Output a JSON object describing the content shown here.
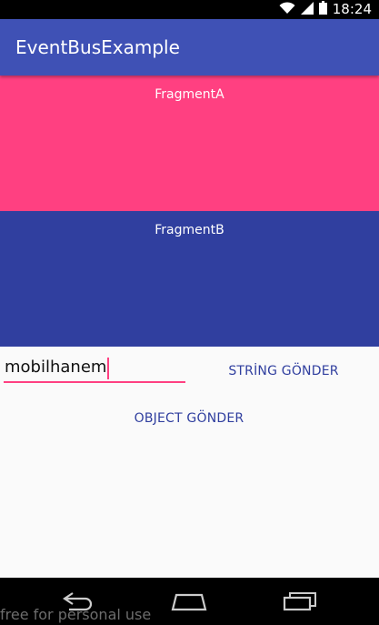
{
  "status_bar": {
    "time": "18:24"
  },
  "app_bar": {
    "title": "EventBusExample"
  },
  "fragments": {
    "a": {
      "label": "FragmentA",
      "color": "#ff4081"
    },
    "b": {
      "label": "FragmentB",
      "color": "#303f9f"
    }
  },
  "form": {
    "input_value": "mobilhanem",
    "string_button": "STRİNG GÖNDER",
    "object_button": "OBJECT GÖNDER"
  },
  "watermark": "free for personal use",
  "colors": {
    "primary": "#3f51b5",
    "accent": "#ff4081",
    "dark": "#303f9f"
  },
  "icons": [
    "wifi-icon",
    "signal-icon",
    "battery-icon",
    "back-icon",
    "home-icon",
    "recents-icon"
  ]
}
